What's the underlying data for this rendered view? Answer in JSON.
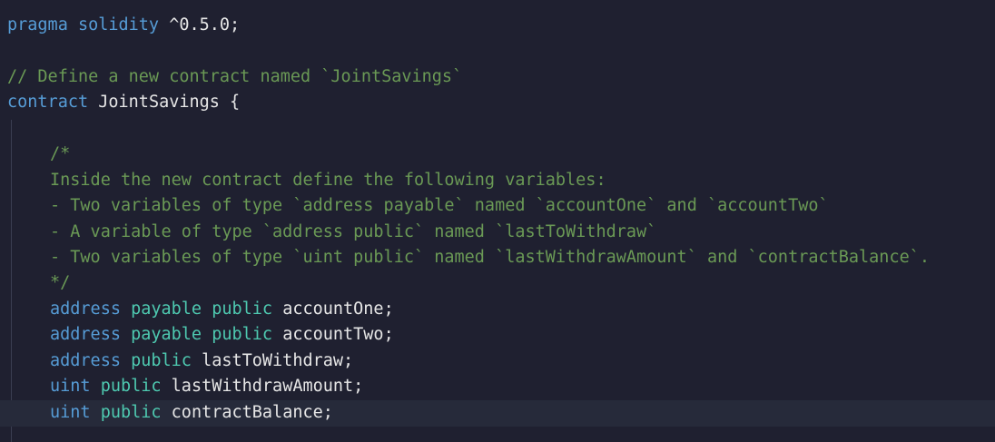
{
  "lines": [
    {
      "parts": [
        {
          "text": "pragma solidity ",
          "cls": "kw"
        },
        {
          "text": "^0.5.0;",
          "cls": "tx"
        }
      ]
    },
    {
      "parts": []
    },
    {
      "parts": [
        {
          "text": "// Define a new contract named `JointSavings`",
          "cls": "cm"
        }
      ]
    },
    {
      "parts": [
        {
          "text": "contract ",
          "cls": "kw"
        },
        {
          "text": "JointSavings {",
          "cls": "tx"
        }
      ]
    },
    {
      "parts": []
    },
    {
      "indent": true,
      "parts": [
        {
          "text": "/*",
          "cls": "cm"
        }
      ]
    },
    {
      "indent": true,
      "parts": [
        {
          "text": "Inside the new contract define the following variables:",
          "cls": "cm"
        }
      ]
    },
    {
      "indent": true,
      "parts": [
        {
          "text": "- Two variables of type `address payable` named `accountOne` and `accountTwo`",
          "cls": "cm"
        }
      ]
    },
    {
      "indent": true,
      "parts": [
        {
          "text": "- A variable of type `address public` named `lastToWithdraw`",
          "cls": "cm"
        }
      ]
    },
    {
      "indent": true,
      "parts": [
        {
          "text": "- Two variables of type `uint public` named `lastWithdrawAmount` and `contractBalance`.",
          "cls": "cm"
        }
      ]
    },
    {
      "indent": true,
      "parts": [
        {
          "text": "*/",
          "cls": "cm"
        }
      ]
    },
    {
      "indent": true,
      "parts": [
        {
          "text": "address ",
          "cls": "kw"
        },
        {
          "text": "payable ",
          "cls": "kw2"
        },
        {
          "text": "public ",
          "cls": "kw2"
        },
        {
          "text": "accountOne;",
          "cls": "tx"
        }
      ]
    },
    {
      "indent": true,
      "parts": [
        {
          "text": "address ",
          "cls": "kw"
        },
        {
          "text": "payable ",
          "cls": "kw2"
        },
        {
          "text": "public ",
          "cls": "kw2"
        },
        {
          "text": "accountTwo;",
          "cls": "tx"
        }
      ]
    },
    {
      "indent": true,
      "parts": [
        {
          "text": "address ",
          "cls": "kw"
        },
        {
          "text": "public ",
          "cls": "kw2"
        },
        {
          "text": "lastToWithdraw;",
          "cls": "tx"
        }
      ]
    },
    {
      "indent": true,
      "parts": [
        {
          "text": "uint ",
          "cls": "kw"
        },
        {
          "text": "public ",
          "cls": "kw2"
        },
        {
          "text": "lastWithdrawAmount;",
          "cls": "tx"
        }
      ]
    },
    {
      "indent": true,
      "active": true,
      "parts": [
        {
          "text": "uint ",
          "cls": "kw"
        },
        {
          "text": "public ",
          "cls": "kw2"
        },
        {
          "text": "contractBalance;",
          "cls": "tx"
        }
      ]
    }
  ],
  "colors": {
    "background": "#1f2030",
    "active_line": "#262a3a",
    "keyword": "#569cd6",
    "modifier": "#4ec9b0",
    "comment": "#6a9955",
    "text": "#e6e6e6"
  }
}
